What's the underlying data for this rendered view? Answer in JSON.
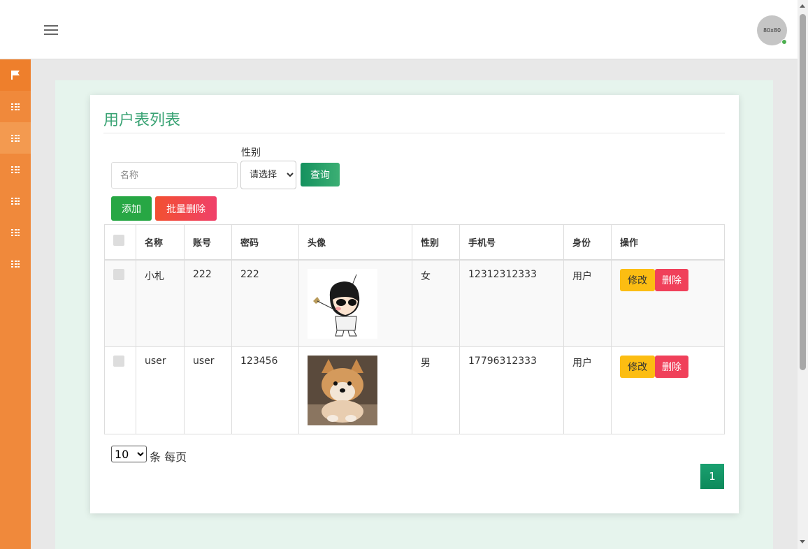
{
  "header": {
    "avatar_text": "80x80"
  },
  "sidebar": {
    "items": [
      {
        "icon": "flag-icon"
      },
      {
        "icon": "grid-icon"
      },
      {
        "icon": "grid-icon"
      },
      {
        "icon": "grid-icon"
      },
      {
        "icon": "grid-icon"
      },
      {
        "icon": "grid-icon"
      },
      {
        "icon": "grid-icon"
      }
    ]
  },
  "page": {
    "title": "用户表列表"
  },
  "search": {
    "name_placeholder": "名称",
    "sex_label": "性别",
    "sex_selected": "请选择",
    "query_label": "查询"
  },
  "actions": {
    "add_label": "添加",
    "batch_delete_label": "批量删除"
  },
  "table": {
    "headers": [
      "名称",
      "账号",
      "密码",
      "头像",
      "性别",
      "手机号",
      "身份",
      "操作"
    ],
    "rows": [
      {
        "name": "小札",
        "account": "222",
        "password": "222",
        "avatar": "cartoon-boy-image",
        "sex": "女",
        "phone": "12312312333",
        "role": "用户"
      },
      {
        "name": "user",
        "account": "user",
        "password": "123456",
        "avatar": "shiba-dog-image",
        "sex": "男",
        "phone": "17796312333",
        "role": "用户"
      }
    ],
    "edit_label": "修改",
    "delete_label": "删除"
  },
  "pagination": {
    "page_size": "10",
    "page_size_label": "条 每页",
    "current_page": "1"
  },
  "colors": {
    "sidebar": "#f0893b",
    "title": "#3aa374",
    "content_bg": "#e6f4ed"
  }
}
